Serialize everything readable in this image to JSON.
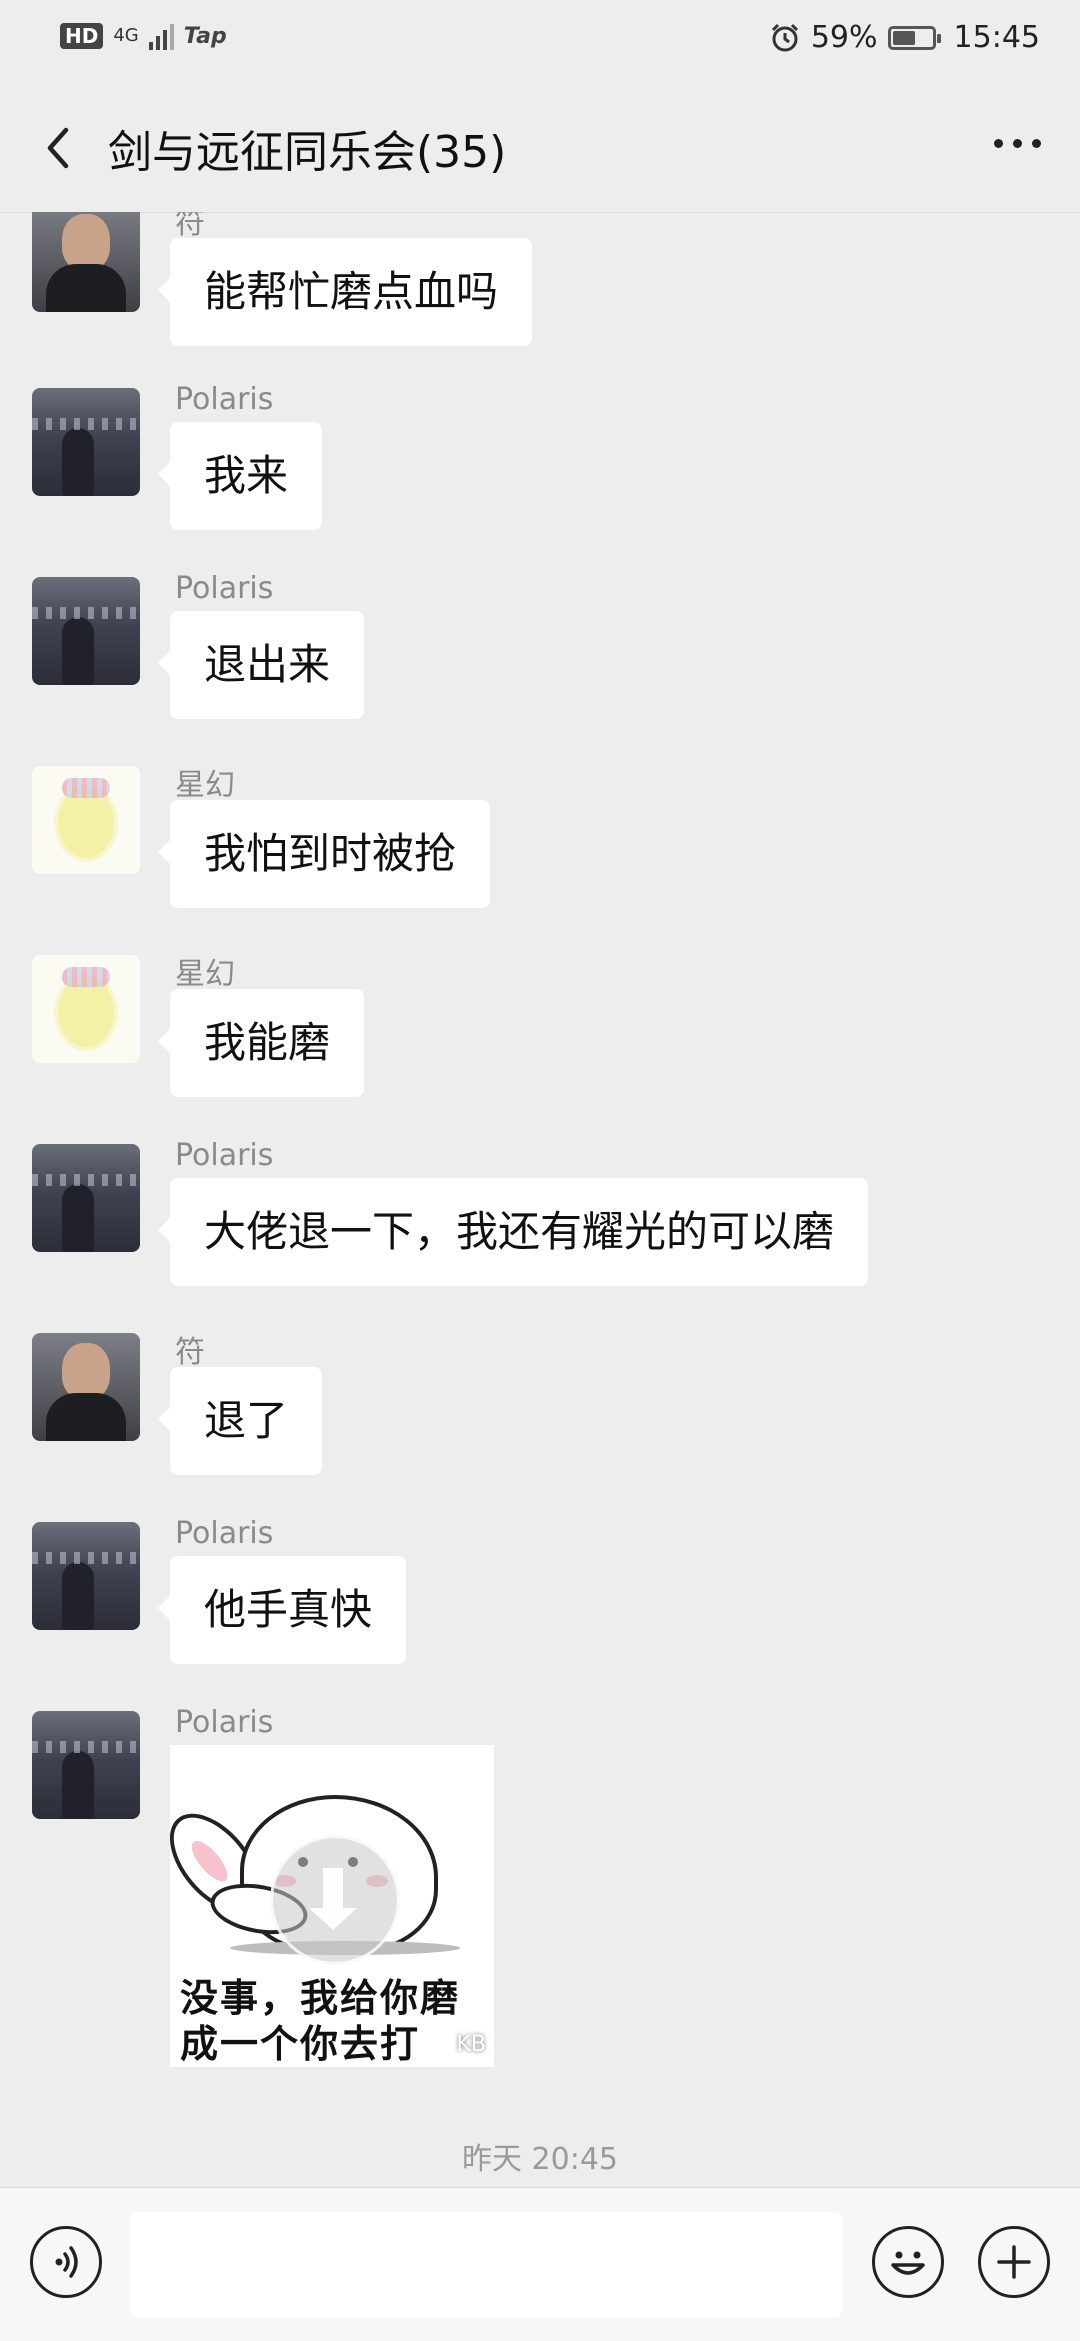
{
  "status_bar": {
    "hd": "HD",
    "network": "4G",
    "carrier": "Tap",
    "battery_text": "59%",
    "battery_level": 0.59,
    "time": "15:45",
    "icons": [
      "alarm-icon",
      "battery-icon",
      "signal-icon"
    ]
  },
  "nav": {
    "title": "剑与远征同乐会(35)",
    "icons": [
      "back-arrow-icon",
      "more-dots-icon"
    ]
  },
  "messages": [
    {
      "sender": "符",
      "text": "能帮忙磨点血吗",
      "avatar": "fu"
    },
    {
      "sender": "Polaris",
      "text": "我来",
      "avatar": "polaris"
    },
    {
      "sender": "Polaris",
      "text": "退出来",
      "avatar": "polaris"
    },
    {
      "sender": "星幻",
      "text": "我怕到时被抢",
      "avatar": "xinghuan"
    },
    {
      "sender": "星幻",
      "text": "我能磨",
      "avatar": "xinghuan"
    },
    {
      "sender": "Polaris",
      "text": "大佬退一下，我还有耀光的可以磨",
      "avatar": "polaris"
    },
    {
      "sender": "符",
      "text": "退了",
      "avatar": "fu"
    },
    {
      "sender": "Polaris",
      "text": "他手真快",
      "avatar": "polaris"
    },
    {
      "sender": "Polaris",
      "avatar": "polaris",
      "sticker": {
        "caption_line1": "没事，我给你磨",
        "caption_line2": "成一个你去打",
        "size_label": "KB"
      }
    }
  ],
  "timestamp": "昨天 20:45",
  "input_bar": {
    "placeholder": "",
    "icons": [
      "voice-icon",
      "emoji-icon",
      "plus-icon"
    ]
  }
}
